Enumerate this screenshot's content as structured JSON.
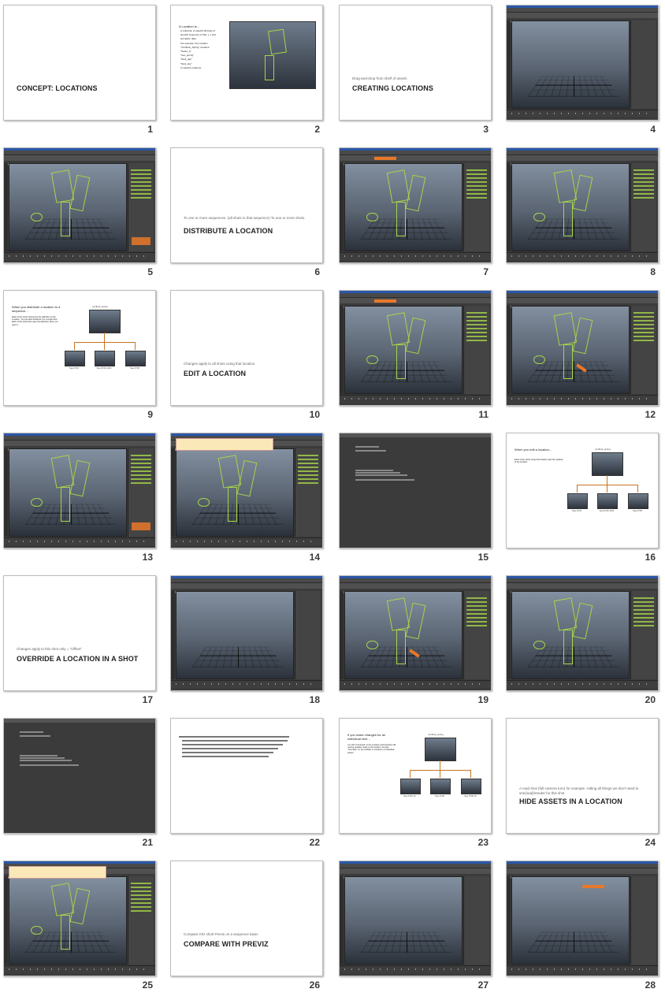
{
  "slides": [
    {
      "n": "1",
      "kind": "title",
      "main": "CONCEPT: LOCATIONS",
      "sub": ""
    },
    {
      "n": "2",
      "kind": "text-image",
      "heading": "A Location is...",
      "lines": [
        "A collection of specific libraries of",
        "specific sequence of that, y, z and",
        "animation data.",
        "For example, the Location",
        "\"Chr/flock_Spring\" contains:",
        "\"flower_A\"",
        "\"tree_spring\"",
        "\"flock_day\"",
        "\"flock_sky\"",
        "In specific positions."
      ]
    },
    {
      "n": "3",
      "kind": "title",
      "main": "CREATING LOCATIONS",
      "sub": "Drag-and-drop from shelf of assets"
    },
    {
      "n": "4",
      "kind": "maya"
    },
    {
      "n": "5",
      "kind": "maya"
    },
    {
      "n": "6",
      "kind": "title",
      "main": "DISTRIBUTE A LOCATION",
      "sub": "To one or more sequences. (all shots in that sequence)\nTo one or more shots."
    },
    {
      "n": "7",
      "kind": "maya"
    },
    {
      "n": "8",
      "kind": "maya"
    },
    {
      "n": "9",
      "kind": "tree",
      "heading": "When you distribute a location to a sequence...",
      "body": "Each of the shots references the definition of the Location. You can also distribute it to a single shot. Each of the shots then gets the definition when you open it.",
      "root": "loc/flock_spring",
      "leaves": [
        "Seq 0710",
        "Seq 0720 sh01",
        "Seq 0730"
      ]
    },
    {
      "n": "10",
      "kind": "title",
      "main": "EDIT A LOCATION",
      "sub": "Changes apply to all shots using that location"
    },
    {
      "n": "11",
      "kind": "maya"
    },
    {
      "n": "12",
      "kind": "maya"
    },
    {
      "n": "13",
      "kind": "maya"
    },
    {
      "n": "14",
      "kind": "maya"
    },
    {
      "n": "15",
      "kind": "dark"
    },
    {
      "n": "16",
      "kind": "tree",
      "heading": "When you edit a location...",
      "body": "Each of the shots using that location gets the updates to the location.",
      "root": "loc/flock_spring",
      "leaves": [
        "Seq 0710",
        "Seq 0720 sh01",
        "Seq 0730"
      ]
    },
    {
      "n": "17",
      "kind": "title",
      "main": "OVERRIDE A LOCATION IN A SHOT",
      "sub": "Changes apply to this shot only = \"Offset\""
    },
    {
      "n": "18",
      "kind": "maya"
    },
    {
      "n": "19",
      "kind": "maya"
    },
    {
      "n": "20",
      "kind": "maya"
    },
    {
      "n": "21",
      "kind": "dark"
    },
    {
      "n": "22",
      "kind": "bullets"
    },
    {
      "n": "23",
      "kind": "tree",
      "heading": "If you make changes for an individual shot...",
      "body": "It is still \"connected\" to the Location and therefore will receive updates made to the location, but has \"overrides\" on the visibility or transform of individual assets.",
      "root": "loc/flock_spring",
      "leaves": [
        "Seq 0710 sh",
        "Seq 0720",
        "Seq 0730 sh"
      ]
    },
    {
      "n": "24",
      "kind": "title",
      "main": "HIDE ASSETS IN A LOCATION",
      "sub": "A road shot (full-camera turn) for example. Hiding all things we don't need to see(load)/render for this shot"
    },
    {
      "n": "25",
      "kind": "maya"
    },
    {
      "n": "26",
      "kind": "title",
      "main": "COMPARE WITH PREVIZ",
      "sub": "Compare IVD shot/ Previs on a sequence basis"
    },
    {
      "n": "27",
      "kind": "maya"
    },
    {
      "n": "28",
      "kind": "maya"
    }
  ],
  "colors": {
    "accent": "#e8782a",
    "geo": "#a6d44a",
    "maya_bg": "#3b3b3b"
  }
}
